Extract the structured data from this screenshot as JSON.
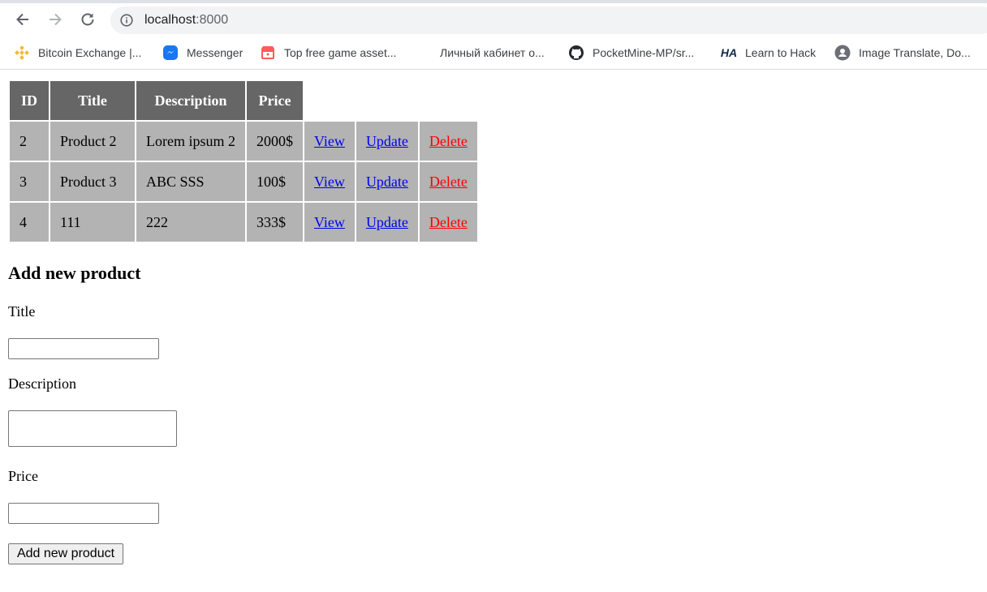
{
  "browser": {
    "url_host": "localhost",
    "url_port": ":8000",
    "bookmarks": [
      {
        "label": "Bitcoin Exchange |...",
        "icon": "binance-icon"
      },
      {
        "label": "Messenger",
        "icon": "messenger-icon"
      },
      {
        "label": "Top free game asset...",
        "icon": "itchio-icon"
      },
      {
        "label": "Личный кабинет о...",
        "icon": "blank-page-icon"
      },
      {
        "label": "PocketMine-MP/sr...",
        "icon": "github-icon"
      },
      {
        "label": "Learn to Hack",
        "icon": "hackademy-icon"
      },
      {
        "label": "Image Translate, Do...",
        "icon": "profile-icon"
      }
    ]
  },
  "table": {
    "headers": [
      "ID",
      "Title",
      "Description",
      "Price"
    ],
    "rows": [
      {
        "id": "2",
        "title": "Product 2",
        "description": "Lorem ipsum 2",
        "price": "2000$",
        "view": "View",
        "update": "Update",
        "delete": "Delete"
      },
      {
        "id": "3",
        "title": "Product 3",
        "description": "ABC SSS",
        "price": "100$",
        "view": "View",
        "update": "Update",
        "delete": "Delete"
      },
      {
        "id": "4",
        "title": "111",
        "description": "222",
        "price": "333$",
        "view": "View",
        "update": "Update",
        "delete": "Delete"
      }
    ]
  },
  "form": {
    "heading": "Add new product",
    "title_label": "Title",
    "title_value": "",
    "description_label": "Description",
    "description_value": "",
    "price_label": "Price",
    "price_value": "",
    "submit_label": "Add new product"
  },
  "colors": {
    "header_bg": "#666666",
    "cell_bg": "#b3b3b3",
    "link": "#0000ee",
    "delete_link": "#ff0000"
  }
}
